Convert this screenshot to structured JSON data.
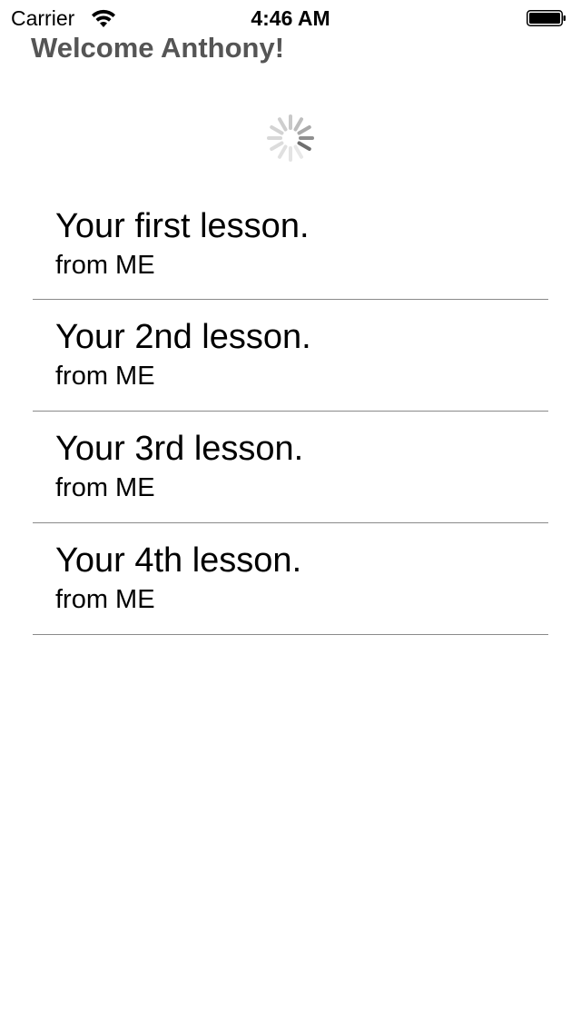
{
  "status_bar": {
    "carrier": "Carrier",
    "time": "4:46 AM",
    "wifi_icon": "wifi-icon",
    "battery_icon": "battery-icon"
  },
  "header": {
    "welcome": "Welcome Anthony!"
  },
  "loading": {
    "icon": "activity-spinner-icon"
  },
  "lessons": [
    {
      "title": "Your first lesson.",
      "subtitle": "from ME"
    },
    {
      "title": "Your 2nd lesson.",
      "subtitle": "from ME"
    },
    {
      "title": "Your 3rd lesson.",
      "subtitle": "from ME"
    },
    {
      "title": "Your 4th lesson.",
      "subtitle": "from ME"
    }
  ],
  "colors": {
    "header_text": "#555555",
    "separator": "#8a8a8a",
    "background": "#ffffff"
  }
}
